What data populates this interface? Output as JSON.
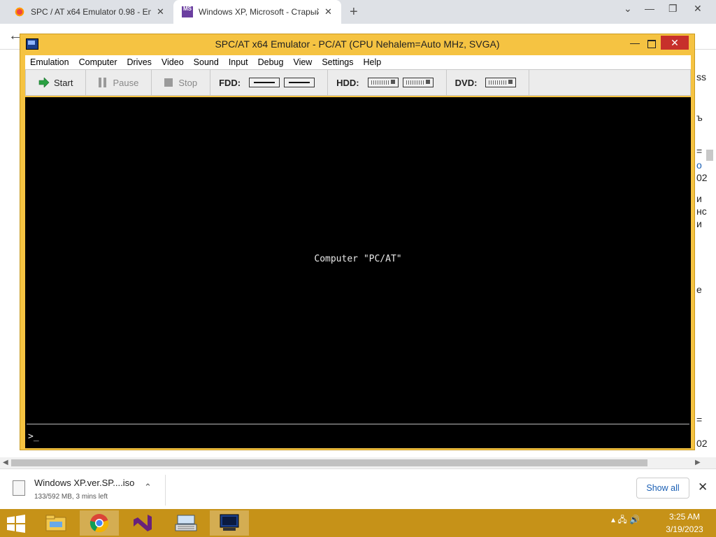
{
  "browser": {
    "tabs": [
      {
        "title": "SPC / AT x64 Emulator 0.98 - Em",
        "favicon": "spc-favicon"
      },
      {
        "title": "Windows XP, Microsoft - Старый",
        "favicon": "ms-favicon"
      }
    ],
    "new_tab": "+",
    "close_glyph": "✕",
    "back_glyph": "←",
    "window_controls": {
      "chevron": "⌄",
      "minimize": "—",
      "restore": "❐",
      "close": "✕"
    },
    "page_fragments": [
      "ss",
      "ъ",
      "=",
      "о",
      "02",
      "и",
      "нс",
      "и",
      "е",
      "=",
      "02",
      "="
    ]
  },
  "emulator": {
    "title": "SPC/AT x64 Emulator - PC/AT (CPU Nehalem=Auto MHz, SVGA)",
    "controls": {
      "minimize": "—",
      "close": "✕"
    },
    "menu": [
      "Emulation",
      "Computer",
      "Drives",
      "Video",
      "Sound",
      "Input",
      "Debug",
      "View",
      "Settings",
      "Help"
    ],
    "toolbar": {
      "start": "Start",
      "pause": "Pause",
      "stop": "Stop",
      "fdd_label": "FDD:",
      "hdd_label": "HDD:",
      "dvd_label": "DVD:"
    },
    "screen_message": "Computer \"PC/AT\"",
    "console_prompt": ">_"
  },
  "download": {
    "filename": "Windows XP.ver.SP....iso",
    "status": "133/592 MB, 3 mins left",
    "show_all": "Show all",
    "chevron": "⌃",
    "close": "✕"
  },
  "taskbar": {
    "items": [
      "file-explorer",
      "chrome",
      "visual-studio",
      "keyboard-app",
      "emulator"
    ],
    "tray_icons": "▴ 🖧 🔊",
    "time": "3:25 AM",
    "date": "3/19/2023"
  },
  "colors": {
    "emulator_frame": "#f5c342",
    "taskbar": "#c69218",
    "close_red": "#c7302b"
  }
}
